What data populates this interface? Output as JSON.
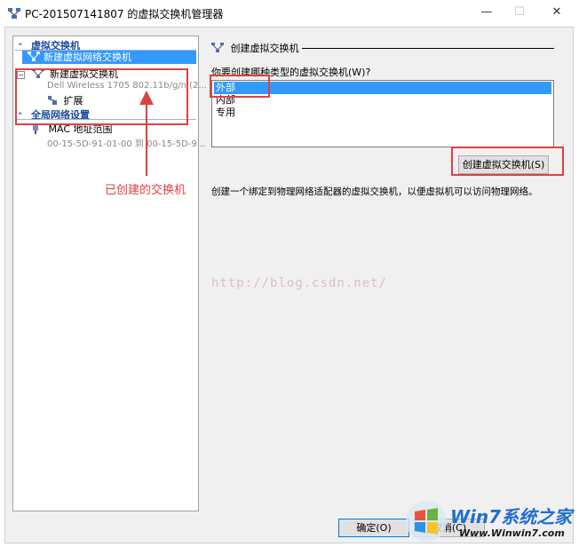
{
  "window": {
    "title": "PC-201507141807 的虚拟交换机管理器",
    "minimize_glyph": "—",
    "maximize_glyph": "☐",
    "close_glyph": "✕"
  },
  "tree": {
    "section1": {
      "title": "虚拟交换机",
      "caret": "⌃"
    },
    "new_switch_item": "新建虚拟网络交换机",
    "existing_switch": {
      "name": "新建虚拟交换机",
      "adapter": "Dell Wireless 1705 802.11b/g/n (2...",
      "expand_child": "扩展",
      "expander": "−"
    },
    "section2": {
      "title": "全局网络设置",
      "caret": "⌃"
    },
    "mac_range": {
      "label": "MAC 地址范围",
      "value": "00-15-5D-91-01-00 到 00-15-5D-9..."
    }
  },
  "right": {
    "header": "创建虚拟交换机",
    "prompt": "你要创建哪种类型的虚拟交换机(W)?",
    "types": [
      "外部",
      "内部",
      "专用"
    ],
    "selected_type_index": 0,
    "create_button": "创建虚拟交换机(S)",
    "description": "创建一个绑定到物理网络适配器的虚拟交换机，以便虚拟机可以访问物理网络。",
    "watermark": "http://blog.csdn.net/"
  },
  "footer": {
    "ok_label": "确定(O)",
    "cancel_label": "取消(C)"
  },
  "annotations": {
    "created_label": "已创建的交换机",
    "color": "#e04040"
  },
  "site_watermark": {
    "brand": "Win7系统之家",
    "url": "Www.Winwin7.com"
  }
}
